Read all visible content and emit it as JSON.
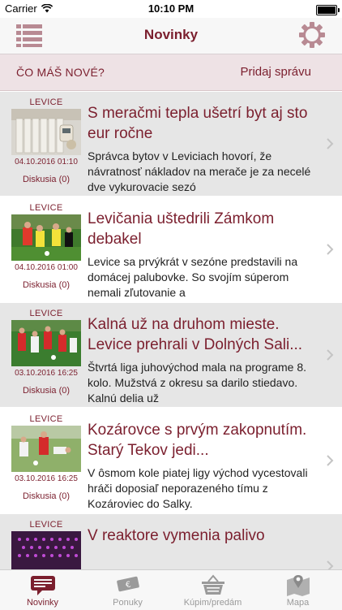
{
  "status_bar": {
    "carrier": "Carrier",
    "time": "10:10 PM"
  },
  "nav": {
    "title": "Novinky",
    "menu_icon": "list-icon",
    "settings_icon": "gear-icon"
  },
  "composer": {
    "prompt": "ČO MÁŠ NOVÉ?",
    "action": "Pridaj správu"
  },
  "articles": [
    {
      "city": "LEVICE",
      "date": "04.10.2016 01:10",
      "comments": "Diskusia (0)",
      "title": "S meračmi tepla ušetrí byt aj sto eur ročne",
      "summary": "Správca bytov v Leviciach hovorí, že návratnosť nákladov na merače je za necelé dve vykurovacie sezó",
      "thumb": "radiator"
    },
    {
      "city": "LEVICE",
      "date": "04.10.2016 01:00",
      "comments": "Diskusia (0)",
      "title": "Levičania uštedrili Zámkom debakel",
      "summary": "Levice sa prvýkrát v sezóne predstavili na domácej palubovke. So svojím súperom nemali zľutovanie a",
      "thumb": "football-yellow"
    },
    {
      "city": "LEVICE",
      "date": "03.10.2016 16:25",
      "comments": "Diskusia (0)",
      "title": "Kalná už na druhom mieste. Levice prehrali v Dolných Sali...",
      "summary": "Štvrtá liga juhovýchod mala na programe 8. kolo. Mužstvá z okresu sa darilo stiedavo. Kalnú delia už",
      "thumb": "football-red"
    },
    {
      "city": "LEVICE",
      "date": "03.10.2016 16:25",
      "comments": "Diskusia (0)",
      "title": "Kozárovce s prvým zakopnutím. Starý Tekov jedi...",
      "summary": "V ôsmom kole piatej ligy východ vycestovali hráči doposiaľ neporazeného tímu z Kozároviec do Salky.",
      "thumb": "football-tackle"
    },
    {
      "city": "LEVICE",
      "date": "",
      "comments": "",
      "title": "V reaktore vymenia palivo",
      "summary": "",
      "thumb": "reactor"
    }
  ],
  "tabs": [
    {
      "label": "Novinky",
      "icon": "news-icon",
      "active": true
    },
    {
      "label": "Ponuky",
      "icon": "offers-icon",
      "active": false
    },
    {
      "label": "Kúpim/predám",
      "icon": "basket-icon",
      "active": false
    },
    {
      "label": "Mapa",
      "icon": "map-icon",
      "active": false
    }
  ],
  "colors": {
    "accent": "#7b1f2e",
    "shade_row": "#e6e6e6",
    "composer_bg": "#eee2e5"
  }
}
